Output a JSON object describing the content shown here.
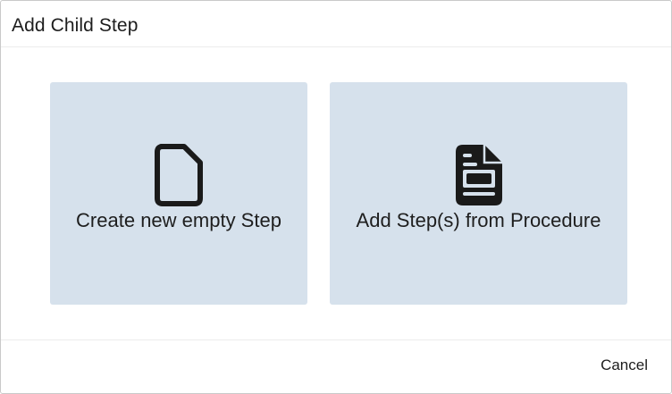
{
  "dialog": {
    "title": "Add Child Step"
  },
  "options": [
    {
      "label": "Create new empty Step",
      "icon": "empty-document-icon"
    },
    {
      "label": "Add Step(s) from Procedure",
      "icon": "procedure-document-icon"
    }
  ],
  "footer": {
    "cancel_label": "Cancel"
  },
  "colors": {
    "card_background": "#d6e1ec",
    "icon_color": "#1a1a1a",
    "text_color": "#1e1e1e"
  }
}
